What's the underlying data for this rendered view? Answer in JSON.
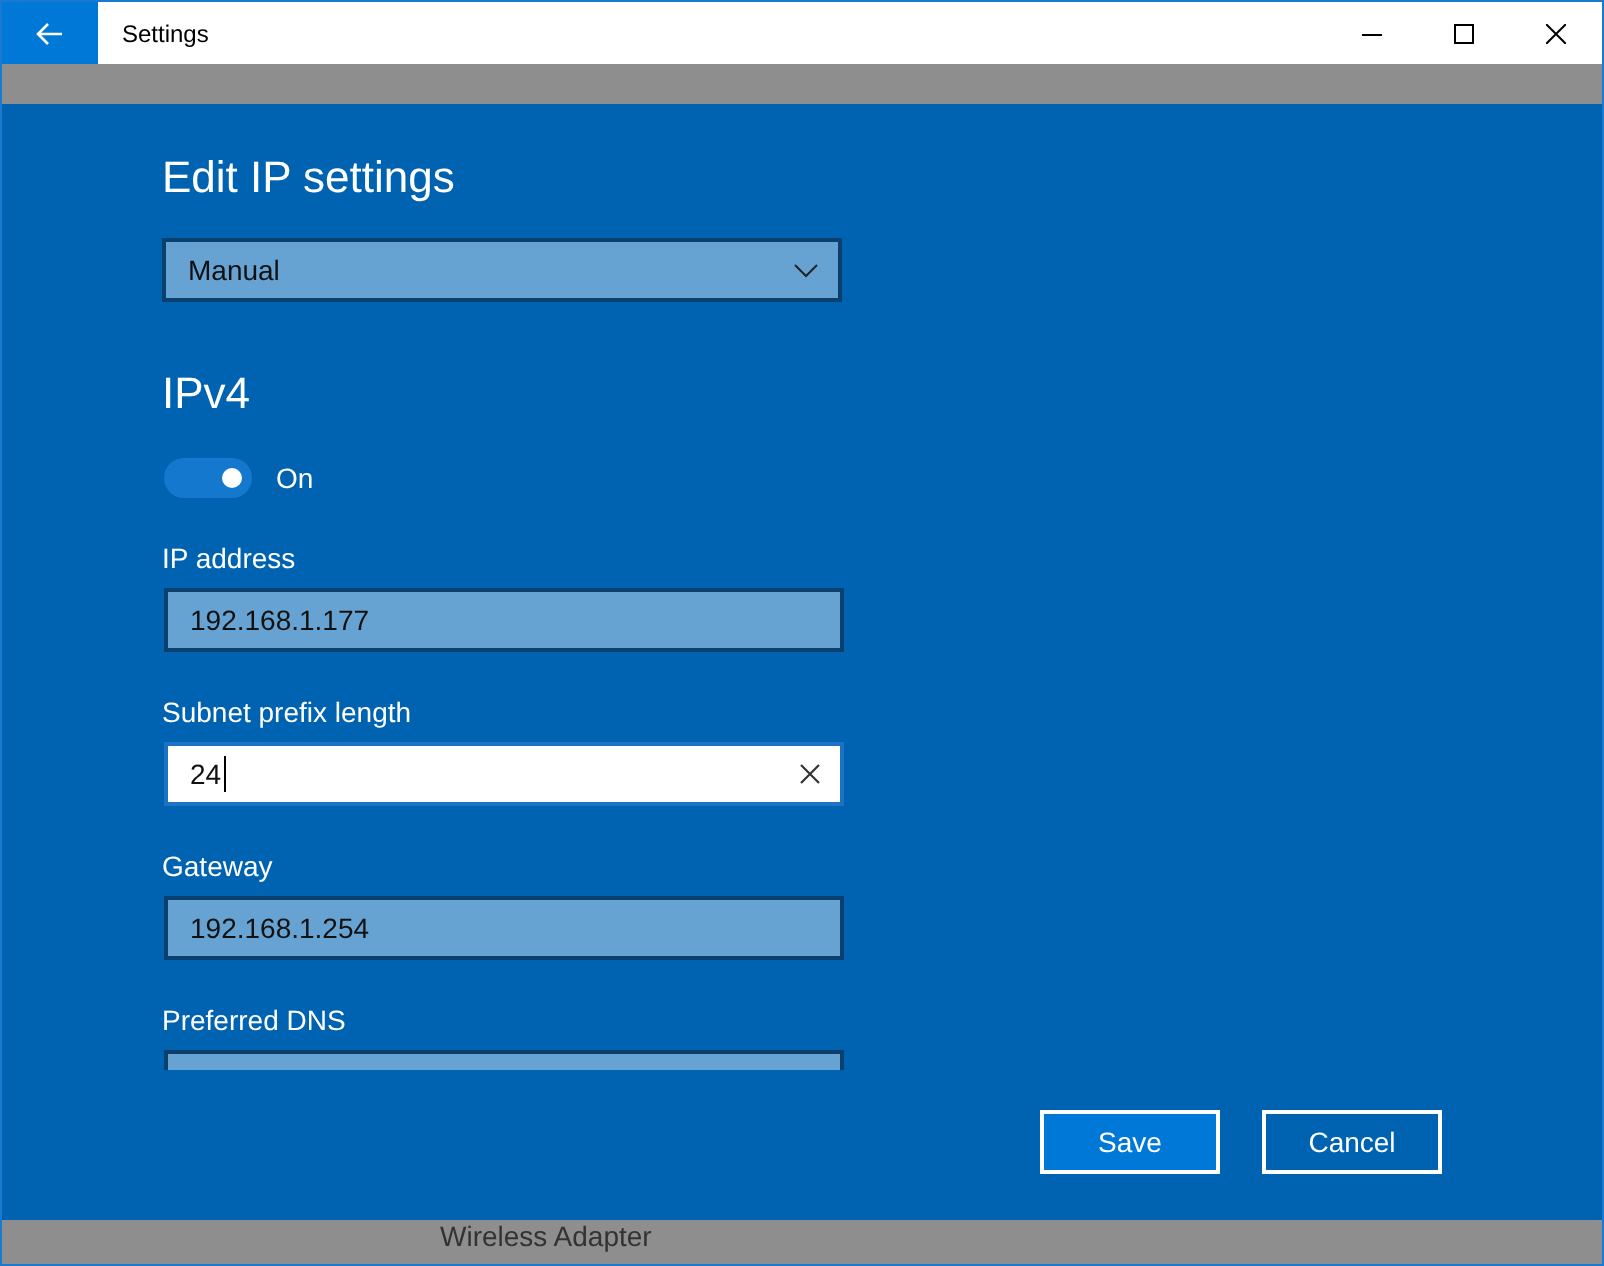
{
  "window": {
    "title": "Settings"
  },
  "dialog": {
    "title": "Edit IP settings",
    "mode_dropdown": {
      "value": "Manual"
    },
    "section": "IPv4",
    "toggle": {
      "on": true,
      "label": "On"
    },
    "fields": [
      {
        "label": "IP address",
        "value": "192.168.1.177",
        "focused": false
      },
      {
        "label": "Subnet prefix length",
        "value": "24",
        "focused": true
      },
      {
        "label": "Gateway",
        "value": "192.168.1.254",
        "focused": false
      },
      {
        "label": "Preferred DNS",
        "focused": false
      }
    ],
    "buttons": [
      {
        "label": "Save",
        "kind": "primary"
      },
      {
        "label": "Cancel",
        "kind": "secondary"
      }
    ]
  },
  "background": {
    "text": "Wireless Adapter"
  }
}
